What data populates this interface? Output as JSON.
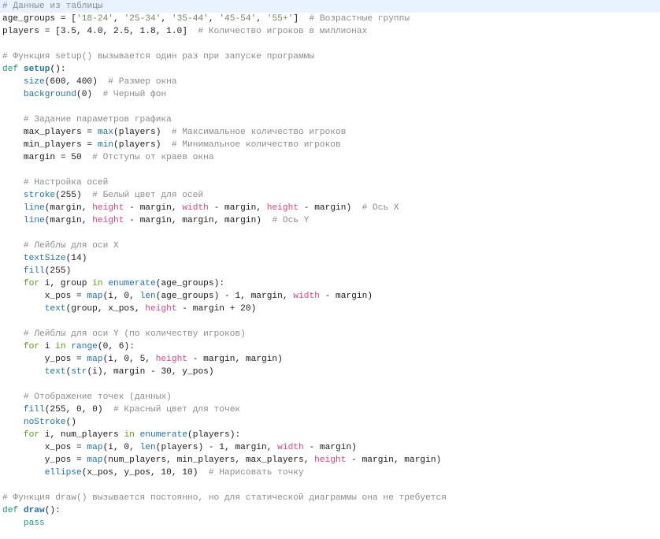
{
  "editor": {
    "active_line": 1,
    "lines": [
      [
        [
          "c",
          "# Данные из таблицы"
        ]
      ],
      [
        [
          "t",
          "age_groups = ["
        ],
        [
          "s",
          "'18-24'"
        ],
        [
          "t",
          ", "
        ],
        [
          "s",
          "'25-34'"
        ],
        [
          "t",
          ", "
        ],
        [
          "s",
          "'35-44'"
        ],
        [
          "t",
          ", "
        ],
        [
          "s",
          "'45-54'"
        ],
        [
          "t",
          ", "
        ],
        [
          "s",
          "'55+'"
        ],
        [
          "t",
          "]  "
        ],
        [
          "c",
          "# Возрастные группы"
        ]
      ],
      [
        [
          "t",
          "players = [3.5, 4.0, 2.5, 1.8, 1.0]  "
        ],
        [
          "c",
          "# Количество игроков в миллионах"
        ]
      ],
      [],
      [
        [
          "c",
          "# Функция setup() вызывается один раз при запуске программы"
        ]
      ],
      [
        [
          "k",
          "def "
        ],
        [
          "d",
          "setup"
        ],
        [
          "t",
          "():"
        ]
      ],
      [
        [
          "t",
          "    "
        ],
        [
          "f",
          "size"
        ],
        [
          "t",
          "(600, 400)  "
        ],
        [
          "c",
          "# Размер окна"
        ]
      ],
      [
        [
          "t",
          "    "
        ],
        [
          "f",
          "background"
        ],
        [
          "t",
          "(0)  "
        ],
        [
          "c",
          "# Черный фон"
        ]
      ],
      [],
      [
        [
          "t",
          "    "
        ],
        [
          "c",
          "# Задание параметров графика"
        ]
      ],
      [
        [
          "t",
          "    max_players = "
        ],
        [
          "f",
          "max"
        ],
        [
          "t",
          "(players)  "
        ],
        [
          "c",
          "# Максимальное количество игроков"
        ]
      ],
      [
        [
          "t",
          "    min_players = "
        ],
        [
          "f",
          "min"
        ],
        [
          "t",
          "(players)  "
        ],
        [
          "c",
          "# Минимальное количество игроков"
        ]
      ],
      [
        [
          "t",
          "    margin = 50  "
        ],
        [
          "c",
          "# Отступы от краев окна"
        ]
      ],
      [],
      [
        [
          "t",
          "    "
        ],
        [
          "c",
          "# Настройка осей"
        ]
      ],
      [
        [
          "t",
          "    "
        ],
        [
          "f",
          "stroke"
        ],
        [
          "t",
          "(255)  "
        ],
        [
          "c",
          "# Белый цвет для осей"
        ]
      ],
      [
        [
          "t",
          "    "
        ],
        [
          "f",
          "line"
        ],
        [
          "t",
          "(margin, "
        ],
        [
          "v",
          "height"
        ],
        [
          "t",
          " - margin, "
        ],
        [
          "v",
          "width"
        ],
        [
          "t",
          " - margin, "
        ],
        [
          "v",
          "height"
        ],
        [
          "t",
          " - margin)  "
        ],
        [
          "c",
          "# Ось X"
        ]
      ],
      [
        [
          "t",
          "    "
        ],
        [
          "f",
          "line"
        ],
        [
          "t",
          "(margin, "
        ],
        [
          "v",
          "height"
        ],
        [
          "t",
          " - margin, margin, margin)  "
        ],
        [
          "c",
          "# Ось Y"
        ]
      ],
      [],
      [
        [
          "t",
          "    "
        ],
        [
          "c",
          "# Лейблы для оси X"
        ]
      ],
      [
        [
          "t",
          "    "
        ],
        [
          "f",
          "textSize"
        ],
        [
          "t",
          "(14)"
        ]
      ],
      [
        [
          "t",
          "    "
        ],
        [
          "f",
          "fill"
        ],
        [
          "t",
          "(255)"
        ]
      ],
      [
        [
          "t",
          "    "
        ],
        [
          "g",
          "for"
        ],
        [
          "t",
          " i, group "
        ],
        [
          "g",
          "in"
        ],
        [
          "t",
          " "
        ],
        [
          "f",
          "enumerate"
        ],
        [
          "t",
          "(age_groups):"
        ]
      ],
      [
        [
          "t",
          "        x_pos = "
        ],
        [
          "f",
          "map"
        ],
        [
          "t",
          "(i, 0, "
        ],
        [
          "f",
          "len"
        ],
        [
          "t",
          "(age_groups) - 1, margin, "
        ],
        [
          "v",
          "width"
        ],
        [
          "t",
          " - margin)"
        ]
      ],
      [
        [
          "t",
          "        "
        ],
        [
          "f",
          "text"
        ],
        [
          "t",
          "(group, x_pos, "
        ],
        [
          "v",
          "height"
        ],
        [
          "t",
          " - margin + 20)"
        ]
      ],
      [],
      [
        [
          "t",
          "    "
        ],
        [
          "c",
          "# Лейблы для оси Y (по количеству игроков)"
        ]
      ],
      [
        [
          "t",
          "    "
        ],
        [
          "g",
          "for"
        ],
        [
          "t",
          " i "
        ],
        [
          "g",
          "in"
        ],
        [
          "t",
          " "
        ],
        [
          "f",
          "range"
        ],
        [
          "t",
          "(0, 6):"
        ]
      ],
      [
        [
          "t",
          "        y_pos = "
        ],
        [
          "f",
          "map"
        ],
        [
          "t",
          "(i, 0, 5, "
        ],
        [
          "v",
          "height"
        ],
        [
          "t",
          " - margin, margin)"
        ]
      ],
      [
        [
          "t",
          "        "
        ],
        [
          "f",
          "text"
        ],
        [
          "t",
          "("
        ],
        [
          "f",
          "str"
        ],
        [
          "t",
          "(i), margin - 30, y_pos)"
        ]
      ],
      [],
      [
        [
          "t",
          "    "
        ],
        [
          "c",
          "# Отображение точек (данных)"
        ]
      ],
      [
        [
          "t",
          "    "
        ],
        [
          "f",
          "fill"
        ],
        [
          "t",
          "(255, 0, 0)  "
        ],
        [
          "c",
          "# Красный цвет для точек"
        ]
      ],
      [
        [
          "t",
          "    "
        ],
        [
          "f",
          "noStroke"
        ],
        [
          "t",
          "()"
        ]
      ],
      [
        [
          "t",
          "    "
        ],
        [
          "g",
          "for"
        ],
        [
          "t",
          " i, num_players "
        ],
        [
          "g",
          "in"
        ],
        [
          "t",
          " "
        ],
        [
          "f",
          "enumerate"
        ],
        [
          "t",
          "(players):"
        ]
      ],
      [
        [
          "t",
          "        x_pos = "
        ],
        [
          "f",
          "map"
        ],
        [
          "t",
          "(i, 0, "
        ],
        [
          "f",
          "len"
        ],
        [
          "t",
          "(players) - 1, margin, "
        ],
        [
          "v",
          "width"
        ],
        [
          "t",
          " - margin)"
        ]
      ],
      [
        [
          "t",
          "        y_pos = "
        ],
        [
          "f",
          "map"
        ],
        [
          "t",
          "(num_players, min_players, max_players, "
        ],
        [
          "v",
          "height"
        ],
        [
          "t",
          " - margin, margin)"
        ]
      ],
      [
        [
          "t",
          "        "
        ],
        [
          "f",
          "ellipse"
        ],
        [
          "t",
          "(x_pos, y_pos, 10, 10)  "
        ],
        [
          "c",
          "# Нарисовать точку"
        ]
      ],
      [],
      [
        [
          "c",
          "# Функция draw() вызывается постоянно, но для статической диаграммы она не требуется"
        ]
      ],
      [
        [
          "k",
          "def "
        ],
        [
          "d",
          "draw"
        ],
        [
          "t",
          "():"
        ]
      ],
      [
        [
          "t",
          "    "
        ],
        [
          "k",
          "pass"
        ]
      ]
    ]
  }
}
